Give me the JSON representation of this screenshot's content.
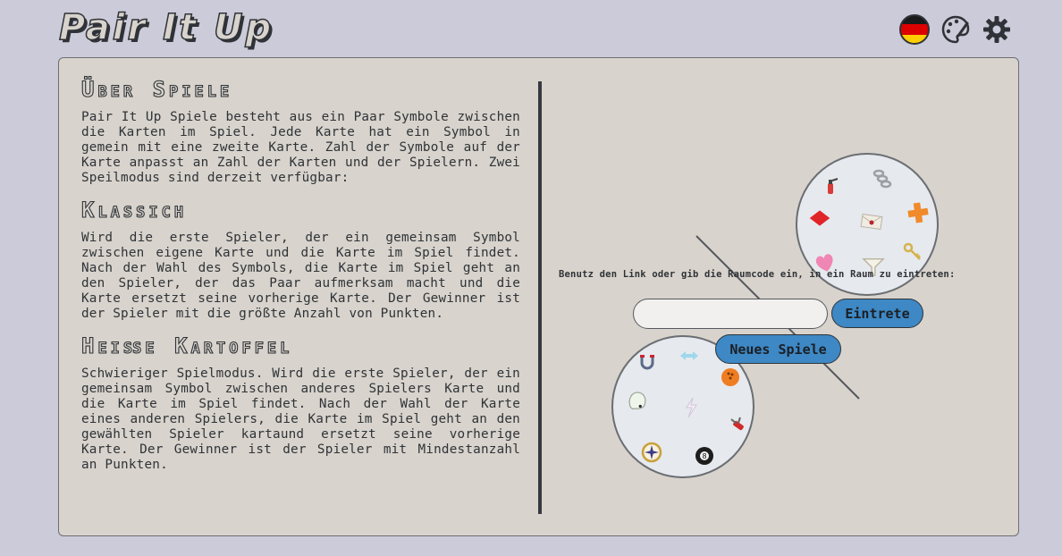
{
  "header": {
    "logo": "Pair It Up",
    "icons": [
      "german-flag-icon",
      "palette-icon",
      "gear-icon"
    ]
  },
  "about": {
    "title": "Über Spiele",
    "text": "Pair It Up Spiele besteht aus ein Paar Symbole zwischen die Karten im Spiel. Jede Karte hat ein Symbol in gemein mit eine zweite Karte. Zahl der Symbole auf der Karte anpasst an Zahl der Karten und der Spielern. Zwei Speilmodus sind derzeit verfügbar:"
  },
  "classic": {
    "title": "Klassich",
    "text": "Wird die erste Spieler, der ein gemeinsam Symbol zwischen eigene Karte und die Karte im Spiel findet. Nach der Wahl des Symbols, die Karte im Spiel geht an den Spieler, der das Paar aufmerksam macht und die Karte ersetzt seine vorherige Karte. Der Gewinner ist der Spieler mit die größte Anzahl von Punkten."
  },
  "hot_potato": {
    "title": "Heiße Kartoffel",
    "text": "Schwieriger Spielmodus. Wird die erste Spieler, der ein gemeinsam Symbol zwischen anderes Spielers Karte und die Karte im Spiel findet. Nach der Wahl der Karte eines anderen Spielers, die Karte im Spiel geht an den gewählten Spieler kartaund ersetzt seine vorherige Karte. Der Gewinner ist der Spieler mit Mindestanzahl an Punkten."
  },
  "join": {
    "instruction": "Benutz den Link oder gib die Raumcode ein, in ein Raum zu eintreten:",
    "input_value": "",
    "input_placeholder": "",
    "join_label": "Eintrete",
    "new_game_label": "Neues Spiele"
  },
  "cards": {
    "top_symbols": [
      "fire-extinguisher-icon",
      "chain-icon",
      "diamond-icon",
      "envelope-icon",
      "cross-icon",
      "key-icon",
      "heart-icon",
      "funnel-icon"
    ],
    "bottom_symbols": [
      "magnet-icon",
      "arrows-icon",
      "bowling-ball-icon",
      "ghost-icon",
      "lightning-icon",
      "pocket-knife-icon",
      "compass-icon",
      "eight-ball-icon"
    ]
  },
  "colors": {
    "background": "#cccbd9",
    "panel": "#d8d3cc",
    "text": "#2f3338",
    "button": "#3d88c5"
  }
}
